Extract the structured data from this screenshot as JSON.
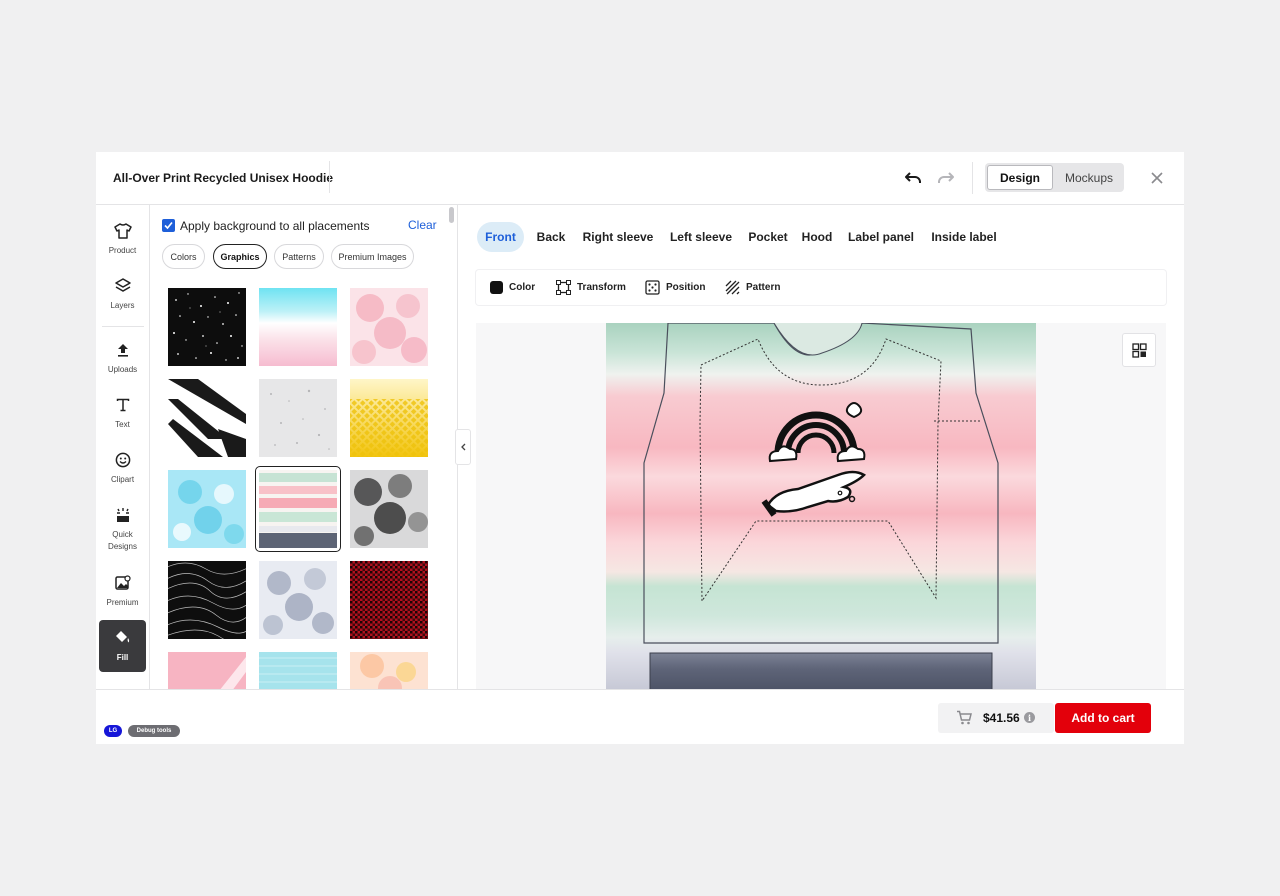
{
  "header": {
    "title": "All-Over Print Recycled Unisex Hoodie",
    "view_toggle": {
      "design_label": "Design",
      "mockups_label": "Mockups",
      "selected": "Design"
    },
    "icons": [
      "undo-icon",
      "redo-icon",
      "close-icon"
    ]
  },
  "rail": {
    "items": [
      {
        "label": "Product",
        "icon": "shirt-icon"
      },
      {
        "label": "Layers",
        "icon": "layers-icon"
      },
      {
        "label": "Uploads",
        "icon": "upload-icon"
      },
      {
        "label": "Text",
        "icon": "text-icon"
      },
      {
        "label": "Clipart",
        "icon": "smiley-icon"
      },
      {
        "label": "Quick\nDesigns",
        "icon": "magic-wand-icon"
      },
      {
        "label": "Premium",
        "icon": "premium-image-icon"
      },
      {
        "label": "Fill",
        "icon": "paint-bucket-icon",
        "active": true
      }
    ]
  },
  "panel": {
    "apply_all_label": "Apply background to all placements",
    "apply_all_checked": true,
    "clear_label": "Clear",
    "chips": [
      {
        "label": "Colors"
      },
      {
        "label": "Graphics",
        "active": true
      },
      {
        "label": "Patterns"
      },
      {
        "label": "Premium Images"
      }
    ],
    "graphics": [
      "black-stars",
      "cyan-pink-fade",
      "pink-tie-dye",
      "black-white-streaks",
      "grey-speckle",
      "yellow-halftone",
      "cyan-tie-dye",
      "pastel-stripes",
      "black-smoke",
      "black-contour-lines",
      "grey-tie-dye",
      "red-black-check",
      "pink-brush",
      "aqua-pattern",
      "peach-tie-dye"
    ],
    "selected_graphic": "pastel-stripes"
  },
  "placements": {
    "tabs": [
      "Front",
      "Back",
      "Right sleeve",
      "Left sleeve",
      "Pocket",
      "Hood",
      "Label panel",
      "Inside label"
    ],
    "active": "Front"
  },
  "toolbar": {
    "color_label": "Color",
    "transform_label": "Transform",
    "position_label": "Position",
    "pattern_label": "Pattern"
  },
  "footer": {
    "badges": [
      "LG",
      "Debug tools"
    ],
    "price": "$41.56",
    "add_to_cart_label": "Add to cart"
  },
  "colors": {
    "accent_blue": "#1e5fd9",
    "active_tab_bg": "#dcecf7",
    "cta_red": "#e3000b",
    "rail_active": "#3a3a3d"
  }
}
